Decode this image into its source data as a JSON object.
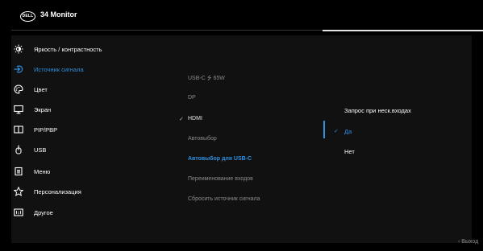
{
  "header": {
    "logo_text": "DELL",
    "title": "34 Monitor"
  },
  "menu": {
    "items": [
      {
        "label": "Яркость / контрастность",
        "icon": "brightness-icon",
        "active": false
      },
      {
        "label": "Источник сигнала",
        "icon": "input-source-icon",
        "active": true
      },
      {
        "label": "Цвет",
        "icon": "color-palette-icon",
        "active": false
      },
      {
        "label": "Экран",
        "icon": "display-icon",
        "active": false
      },
      {
        "label": "PIP/PBP",
        "icon": "pip-icon",
        "active": false
      },
      {
        "label": "USB",
        "icon": "usb-icon",
        "active": false
      },
      {
        "label": "Меню",
        "icon": "menu-icon",
        "active": false
      },
      {
        "label": "Персонализация",
        "icon": "star-icon",
        "active": false
      },
      {
        "label": "Другое",
        "icon": "other-icon",
        "active": false
      }
    ]
  },
  "submenu": {
    "items": [
      {
        "label": "USB-C ⭍ 65W",
        "state": "normal"
      },
      {
        "label": "DP",
        "state": "normal"
      },
      {
        "label": "HDMI",
        "state": "checked"
      },
      {
        "label": "Автовыбор",
        "state": "normal"
      },
      {
        "label": "Автовыбор для USB-C",
        "state": "active"
      },
      {
        "label": "Переименование входов",
        "state": "normal"
      },
      {
        "label": "Сбросить  источник сигнала",
        "state": "normal"
      }
    ]
  },
  "options": {
    "title": "Запрос при неск.входах",
    "items": [
      {
        "label": "Да",
        "selected": true
      },
      {
        "label": "Нет",
        "selected": false
      }
    ]
  },
  "footer": {
    "exit_label": "‹ Выход"
  },
  "colors": {
    "accent": "#2f8fe0",
    "background": "#000000",
    "panel": "#111111",
    "dim_text": "#8a8a8a"
  }
}
